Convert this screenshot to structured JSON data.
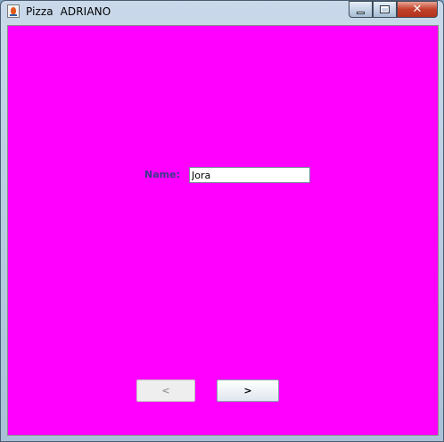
{
  "window": {
    "title": "Pizza  ADRIANO",
    "controls": {
      "minimize": "",
      "maximize": "",
      "close": "✕"
    }
  },
  "form": {
    "name_label": "Name:",
    "name_value": "Jora"
  },
  "navigation": {
    "prev_label": "<",
    "next_label": ">"
  },
  "colors": {
    "content_background": "#ff00ff",
    "label_text": "#3a3a88"
  },
  "icons": {
    "app": "java-cup-icon",
    "minimize": "minimize-icon",
    "maximize": "maximize-icon",
    "close": "close-icon"
  }
}
